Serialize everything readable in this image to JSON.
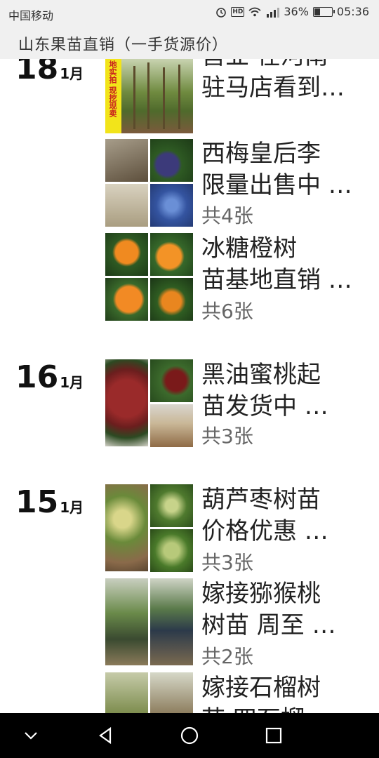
{
  "status": {
    "carrier": "中国移动",
    "battery": "36%",
    "time": "05:36",
    "network": "4G"
  },
  "app": {
    "title": "山东果苗直销（一手货源价）"
  },
  "days": [
    {
      "day": "18",
      "month": "1月"
    },
    {
      "day": "16",
      "month": "1月"
    },
    {
      "day": "15",
      "month": "1月"
    }
  ],
  "posts": [
    {
      "line1": "营业 在河南",
      "line2": "驻马店看到…",
      "count": "",
      "banner": "地实拍 现挖现卖"
    },
    {
      "line1": "西梅皇后李",
      "line2": "限量出售中 …",
      "count": "共4张"
    },
    {
      "line1": "冰糖橙树",
      "line2": "苗基地直销 …",
      "count": "共6张"
    },
    {
      "line1": "黑油蜜桃起",
      "line2": "苗发货中  …",
      "count": "共3张"
    },
    {
      "line1": "葫芦枣树苗",
      "line2": "价格优惠  …",
      "count": "共3张"
    },
    {
      "line1": "嫁接猕猴桃",
      "line2": "树苗  周至  …",
      "count": "共2张"
    },
    {
      "line1": "嫁接石榴树",
      "line2": "苗  四石榴",
      "count": ""
    }
  ],
  "colors": {
    "header_bg": "#f0f0f0",
    "nav_bg": "#000000",
    "count_text": "#666666"
  }
}
